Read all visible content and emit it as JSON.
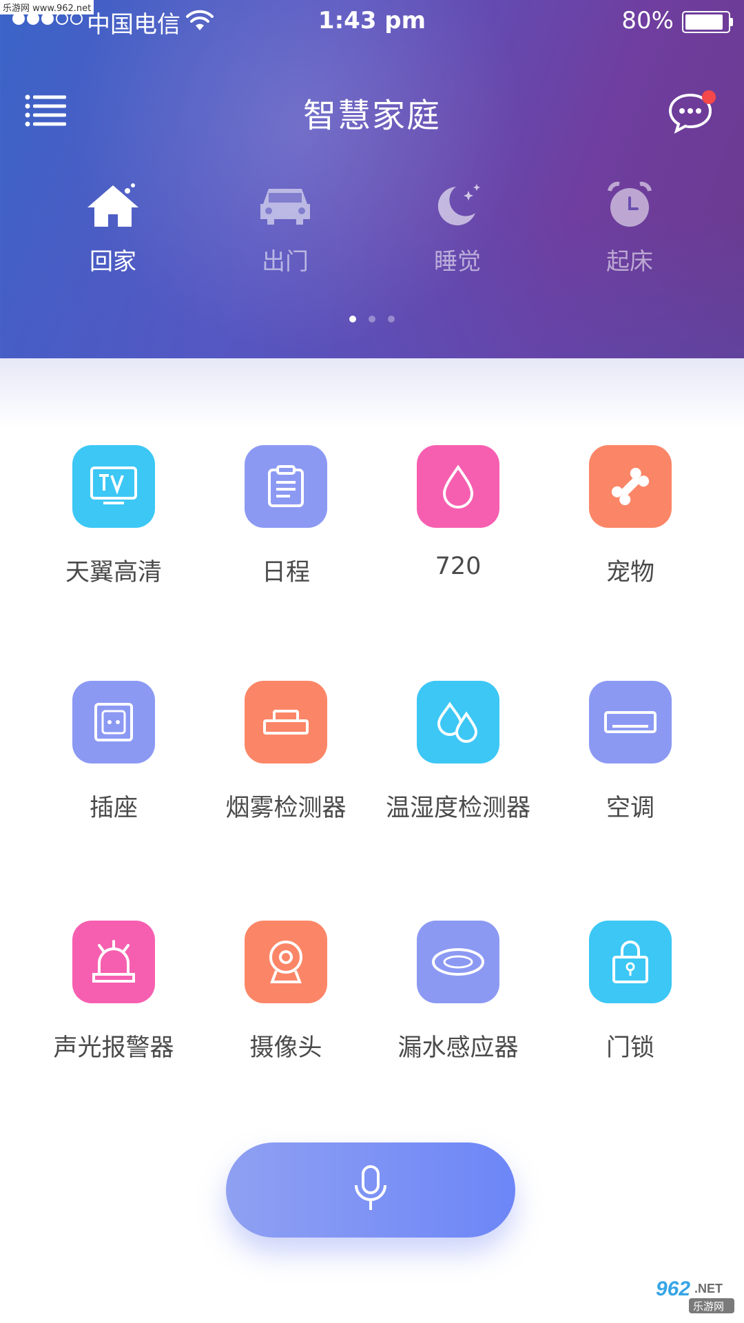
{
  "watermark": "乐游网 www.962.net",
  "status_bar": {
    "carrier": "中国电信",
    "time": "1:43 pm",
    "battery": "80%",
    "battery_level": 0.8,
    "signal_filled": 3,
    "signal_total": 5
  },
  "header": {
    "title": "智慧家庭",
    "menu_icon": "list-menu-icon",
    "message_icon": "chat-bubble-icon",
    "has_notification": true
  },
  "modes": [
    {
      "label": "回家",
      "icon": "home-icon",
      "active": true
    },
    {
      "label": "出门",
      "icon": "car-icon",
      "active": false
    },
    {
      "label": "睡觉",
      "icon": "moon-icon",
      "active": false
    },
    {
      "label": "起床",
      "icon": "alarm-clock-icon",
      "active": false
    }
  ],
  "pager": {
    "count": 3,
    "current": 0
  },
  "devices": [
    {
      "label": "天翼高清",
      "icon": "tv-icon",
      "color": "#3cc7f5"
    },
    {
      "label": "日程",
      "icon": "clipboard-icon",
      "color": "#8c99f3"
    },
    {
      "label": "720",
      "icon": "drop-icon",
      "color": "#f65fb0"
    },
    {
      "label": "宠物",
      "icon": "bone-icon",
      "color": "#fb8667"
    },
    {
      "label": "插座",
      "icon": "socket-icon",
      "color": "#8c99f3"
    },
    {
      "label": "烟雾检测器",
      "icon": "smoke-detector-icon",
      "color": "#fb8667"
    },
    {
      "label": "温湿度检测器",
      "icon": "humidity-icon",
      "color": "#3cc7f5"
    },
    {
      "label": "空调",
      "icon": "air-conditioner-icon",
      "color": "#8c99f3"
    },
    {
      "label": "声光报警器",
      "icon": "alarm-light-icon",
      "color": "#f65fb0"
    },
    {
      "label": "摄像头",
      "icon": "camera-icon",
      "color": "#fb8667"
    },
    {
      "label": "漏水感应器",
      "icon": "water-leak-icon",
      "color": "#8c99f3"
    },
    {
      "label": "门锁",
      "icon": "lock-icon",
      "color": "#3cc7f5"
    }
  ],
  "voice": {
    "icon": "microphone-icon"
  },
  "corner_logo": "962.NET 乐游网"
}
